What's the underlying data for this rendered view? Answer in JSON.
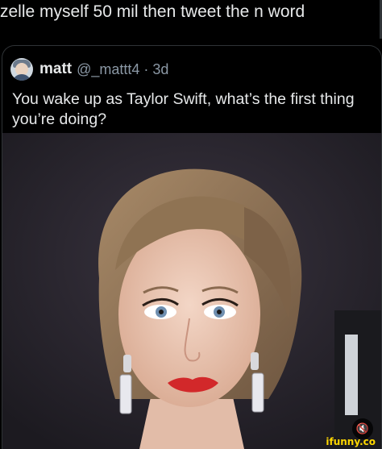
{
  "caption": {
    "text": "zelle myself 50 mil then tweet the n word"
  },
  "quoted_tweet": {
    "author_name": "matt",
    "handle_and_time": "@_mattt4 · 3d",
    "text": "You wake up as Taylor Swift, what’s the first thing you’re doing?"
  },
  "media": {
    "mute_icon": "speaker-muted-icon",
    "mute_glyph": "🔇"
  },
  "watermark": {
    "text": "ifunny.co"
  },
  "colors": {
    "background": "#000000",
    "text_primary": "#e7e9ea",
    "text_secondary": "#8b98a5",
    "border": "#2f3336",
    "watermark": "#ffd700"
  }
}
